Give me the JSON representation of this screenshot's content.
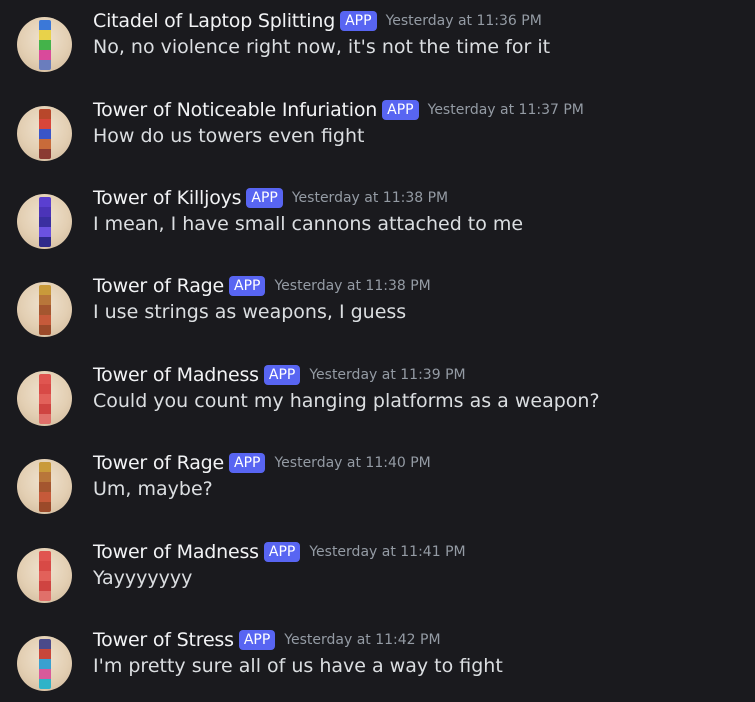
{
  "app_badge_label": "APP",
  "colors": {
    "background": "#1a1a1e",
    "username": "#f2f3f5",
    "message_text": "#dbdee1",
    "timestamp": "#949ba4",
    "app_badge": "#5865f2"
  },
  "messages": [
    {
      "username": "Citadel of Laptop Splitting",
      "timestamp": "Yesterday at 11:36 PM",
      "text": "No, no violence right now, it's not the time for it",
      "avatar_icon": "tower-avatar-icon",
      "avatar_colors": [
        "#3b78d8",
        "#e8d24a",
        "#44b34a",
        "#d94a9b",
        "#6a7dbd"
      ]
    },
    {
      "username": "Tower of Noticeable Infuriation",
      "timestamp": "Yesterday at 11:37 PM",
      "text": "How do us towers even fight",
      "avatar_icon": "tower-avatar-icon",
      "avatar_colors": [
        "#b8472b",
        "#d8463a",
        "#3a55c8",
        "#c86b3a",
        "#8a3b32"
      ]
    },
    {
      "username": "Tower of Killjoys",
      "timestamp": "Yesterday at 11:38 PM",
      "text": "I mean, I have small cannons attached to me",
      "avatar_icon": "tower-avatar-icon",
      "avatar_colors": [
        "#5a3fd0",
        "#4b34b8",
        "#3a2fa0",
        "#6b52e0",
        "#2f2a8a"
      ]
    },
    {
      "username": "Tower of Rage",
      "timestamp": "Yesterday at 11:38 PM",
      "text": "I use strings as weapons, I guess",
      "avatar_icon": "tower-avatar-icon",
      "avatar_colors": [
        "#c99a3a",
        "#b8763a",
        "#a4562f",
        "#c65a3a",
        "#9b4a2a"
      ]
    },
    {
      "username": "Tower of Madness",
      "timestamp": "Yesterday at 11:39 PM",
      "text": "Could you count my hanging platforms as a weapon?",
      "avatar_icon": "tower-avatar-icon",
      "avatar_colors": [
        "#e05550",
        "#d84a46",
        "#e2615a",
        "#cf4441",
        "#e0706a"
      ]
    },
    {
      "username": "Tower of Rage",
      "timestamp": "Yesterday at 11:40 PM",
      "text": "Um, maybe?",
      "avatar_icon": "tower-avatar-icon",
      "avatar_colors": [
        "#c99a3a",
        "#b8763a",
        "#a4562f",
        "#c65a3a",
        "#9b4a2a"
      ]
    },
    {
      "username": "Tower of Madness",
      "timestamp": "Yesterday at 11:41 PM",
      "text": "Yayyyyyyy",
      "avatar_icon": "tower-avatar-icon",
      "avatar_colors": [
        "#e05550",
        "#d84a46",
        "#e2615a",
        "#cf4441",
        "#e0706a"
      ]
    },
    {
      "username": "Tower of Stress",
      "timestamp": "Yesterday at 11:42 PM",
      "text": "I'm pretty sure all of us have a way to fight",
      "avatar_icon": "tower-avatar-icon",
      "avatar_colors": [
        "#4a4a8a",
        "#c8463a",
        "#3aa0d0",
        "#d85a9a",
        "#2fb3c8"
      ]
    }
  ]
}
